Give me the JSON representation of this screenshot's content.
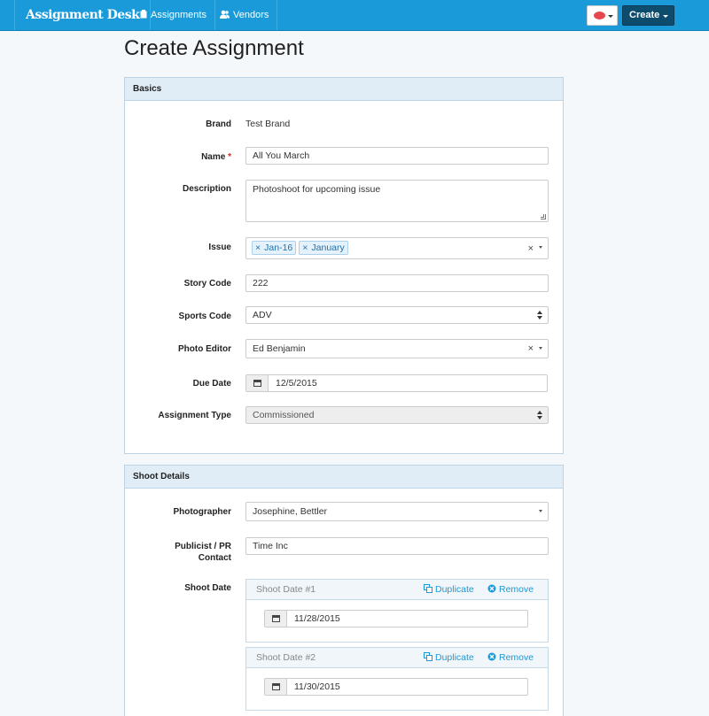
{
  "nav": {
    "brand": "Assignment Desk",
    "assignments": "Assignments",
    "vendors": "Vendors",
    "create": "Create"
  },
  "page_title": "Create Assignment",
  "basics": {
    "heading": "Basics",
    "brand_label": "Brand",
    "brand_value": "Test Brand",
    "name_label": "Name",
    "name_required": "*",
    "name_value": "All You March",
    "description_label": "Description",
    "description_value": "Photoshoot for upcoming issue",
    "issue_label": "Issue",
    "issue_tags": [
      "Jan-16",
      "January"
    ],
    "story_code_label": "Story Code",
    "story_code_value": "222",
    "sports_code_label": "Sports Code",
    "sports_code_value": "ADV",
    "photo_editor_label": "Photo Editor",
    "photo_editor_value": "Ed Benjamin",
    "due_date_label": "Due Date",
    "due_date_value": "12/5/2015",
    "assignment_type_label": "Assignment Type",
    "assignment_type_value": "Commissioned"
  },
  "shoot": {
    "heading": "Shoot Details",
    "photographer_label": "Photographer",
    "photographer_value": "Josephine, Bettler",
    "publicist_label_1": "Publicist / PR",
    "publicist_label_2": "Contact",
    "publicist_value": "Time Inc",
    "shoot_date_label": "Shoot Date",
    "duplicate_label": "Duplicate",
    "remove_label": "Remove",
    "dates": [
      {
        "title": "Shoot Date #1",
        "value": "11/28/2015"
      },
      {
        "title": "Shoot Date #2",
        "value": "11/30/2015"
      }
    ]
  },
  "colors": {
    "navbar": "#1a9ad9",
    "create_button": "#0e4c6e",
    "panel_heading": "#e1edf6",
    "link": "#1a9ad9",
    "required": "#d9261c"
  },
  "icons": [
    "clipboard-icon",
    "users-icon",
    "flag-icon",
    "calendar-icon",
    "duplicate-icon",
    "remove-icon",
    "chevron-down-icon"
  ]
}
